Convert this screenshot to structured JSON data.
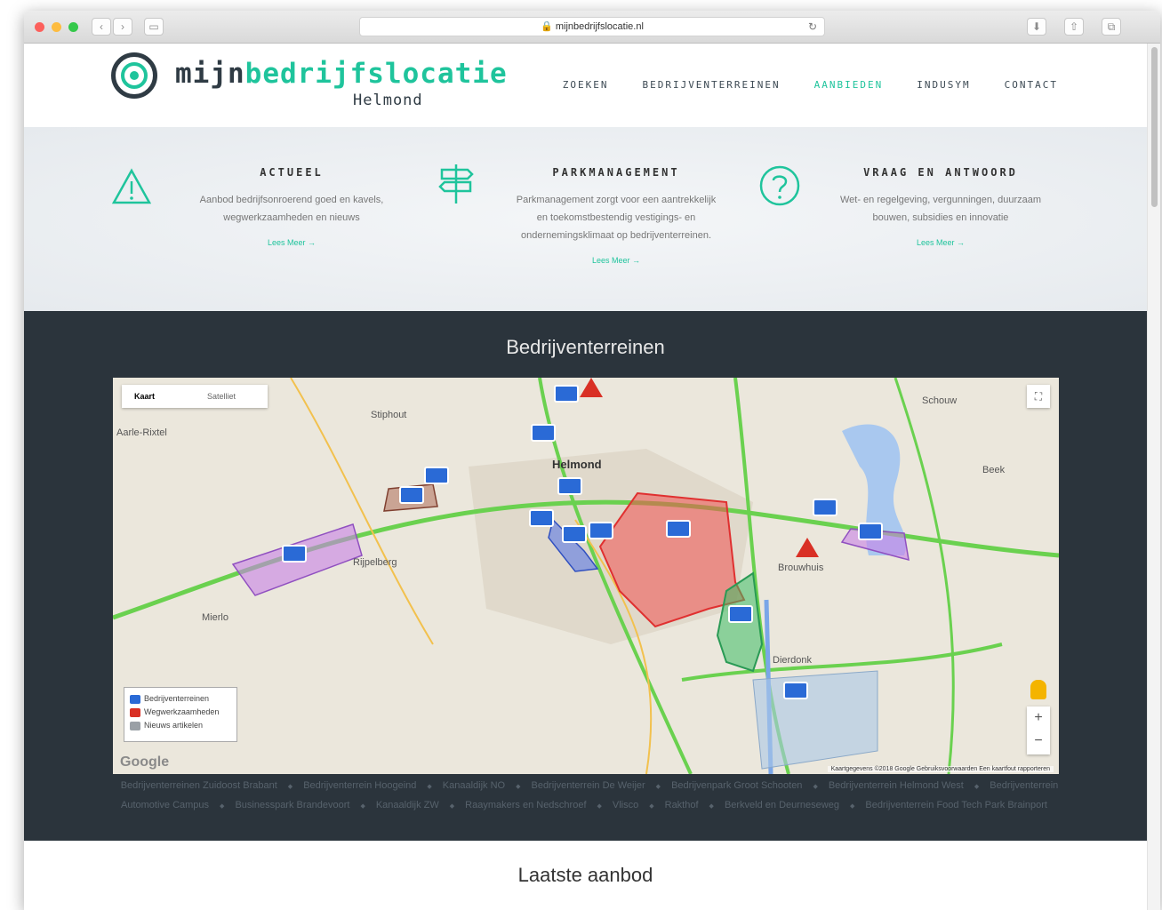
{
  "browser": {
    "url": "mijnbedrijfslocatie.nl"
  },
  "brand": {
    "part1": "mijn",
    "part2": "bedrijfslocatie",
    "city": "Helmond",
    "accent": "#1fc49c",
    "dark": "#2f3b44"
  },
  "nav": {
    "items": [
      {
        "label": "ZOEKEN",
        "active": false
      },
      {
        "label": "BEDRIJVENTERREINEN",
        "active": false
      },
      {
        "label": "AANBIEDEN",
        "active": true
      },
      {
        "label": "INDUSYM",
        "active": false
      },
      {
        "label": "CONTACT",
        "active": false
      }
    ]
  },
  "features": [
    {
      "icon": "warning-triangle-icon",
      "title": "ACTUEEL",
      "text": [
        "Aanbod bedrijfsonroerend goed en kavels,",
        "wegwerkzaamheden en nieuws"
      ],
      "more": "Lees Meer →"
    },
    {
      "icon": "signpost-icon",
      "title": "PARKMANAGEMENT",
      "text": [
        "Parkmanagement zorgt voor een aantrekkelijk",
        "en toekomstbestendig vestigings- en",
        "ondernemingsklimaat op bedrijventerreinen."
      ],
      "more": "Lees Meer →"
    },
    {
      "icon": "question-circle-icon",
      "title": "VRAAG EN ANTWOORD",
      "text": [
        "Wet- en regelgeving, vergunningen, duurzaam",
        "bouwen, subsidies en innovatie"
      ],
      "more": "Lees Meer →"
    }
  ],
  "section_title": "Bedrijventerreinen",
  "map": {
    "tabs": [
      "Kaart",
      "Satelliet"
    ],
    "legend": [
      "Bedrijventerreinen",
      "Wegwerkzaamheden",
      "Nieuws artikelen"
    ],
    "google": "Google",
    "credit": "Kaartgegevens ©2018 Google   Gebruiksvoorwaarden   Een kaartfout rapporteren",
    "places": [
      "Helmond",
      "Stiphout",
      "Schouw",
      "Beek",
      "Aarle-Rixtel",
      "Mierlo",
      "Brouwhuis",
      "Dierdonk",
      "Rijpelberg"
    ]
  },
  "links": [
    "Bedrijventerreinen Zuidoost Brabant",
    "Bedrijventerrein Hoogeind",
    "Kanaaldijk NO",
    "Bedrijventerrein De Weijer",
    "Bedrijvenpark Groot Schooten",
    "Bedrijventerrein Helmond West",
    "Bedrijventerrein Automotive Campus",
    "Businesspark Brandevoort",
    "Kanaaldijk ZW",
    "Raaymakers en Nedschroef",
    "Vlisco",
    "Rakthof",
    "Berkveld en Deurneseweg",
    "Bedrijventerrein Food Tech Park Brainport"
  ],
  "latest_title": "Laatste aanbod"
}
